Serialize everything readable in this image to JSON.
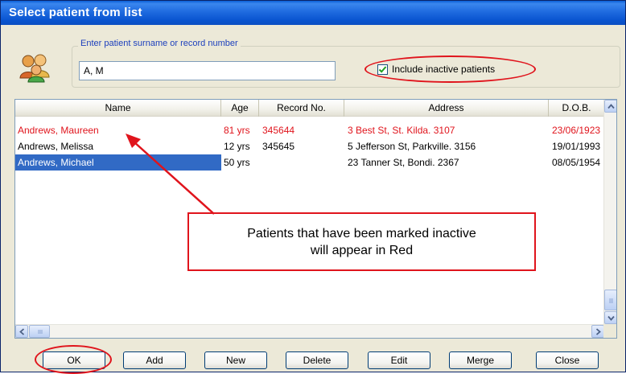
{
  "window": {
    "title": "Select patient from list"
  },
  "search": {
    "legend": "Enter patient surname or record number",
    "value": "A, M",
    "include_inactive_label": "Include inactive patients",
    "include_inactive_checked": true
  },
  "list": {
    "columns": [
      "Name",
      "Age",
      "Record No.",
      "Address",
      "D.O.B."
    ],
    "rows": [
      {
        "name": "Andrews, Maureen",
        "age": "81 yrs",
        "record": "345644",
        "address": "3 Best St, St. Kilda. 3107",
        "dob": "23/06/1923",
        "status": "inactive"
      },
      {
        "name": "Andrews, Melissa",
        "age": "12 yrs",
        "record": "345645",
        "address": "5 Jefferson St, Parkville. 3156",
        "dob": "19/01/1993",
        "status": "active"
      },
      {
        "name": "Andrews, Michael",
        "age": "50 yrs",
        "record": "",
        "address": "23 Tanner St, Bondi. 2367",
        "dob": "08/05/1954",
        "status": "selected"
      }
    ]
  },
  "callout": {
    "text": "Patients that have been marked inactive\nwill appear in Red"
  },
  "buttons": {
    "ok": "OK",
    "add": "Add",
    "new": "New",
    "delete": "Delete",
    "edit": "Edit",
    "merge": "Merge",
    "close": "Close"
  },
  "colors": {
    "annotation": "#e0141c",
    "inactive_text": "#e0141c",
    "selection": "#316ac5",
    "titlebar": "#0a55d0"
  },
  "icons": {
    "patients": "patients-group-icon",
    "check": "checkmark-icon"
  }
}
